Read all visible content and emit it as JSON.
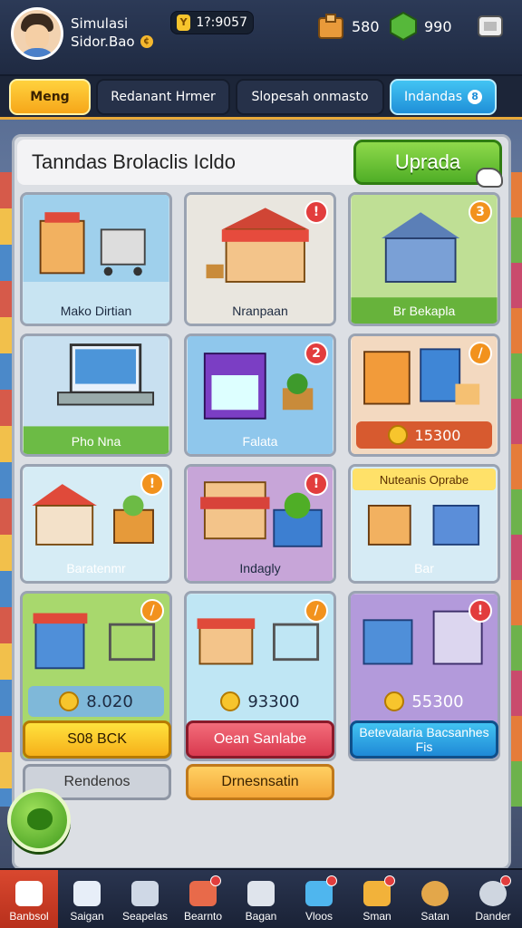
{
  "player": {
    "name": "Simulasi",
    "subtitle": "Sidor.Bao",
    "sub_icon": "coin-mini-icon"
  },
  "currency": {
    "coins": "1?:9057",
    "icon_label": "Y"
  },
  "resources": [
    {
      "value": "580",
      "icon": "box-icon",
      "color": "#e89a3a"
    },
    {
      "value": "990",
      "icon": "cash-icon",
      "color": "#56b83a"
    }
  ],
  "tabs": [
    {
      "label": "Meng"
    },
    {
      "label": "Redanant Hrmer"
    },
    {
      "label": "Slopesah onmasto"
    },
    {
      "label": "Indandas",
      "badge": "8"
    }
  ],
  "panel": {
    "title": "Tanndas Brolaclis Icldo",
    "upgrade_label": "Uprada"
  },
  "cards": [
    {
      "label": "Mako Dirtian",
      "bg": "#9fd0ec"
    },
    {
      "label": "Nranpaan",
      "bg": "#e9e6df",
      "badge": "!"
    },
    {
      "label": "Br Bekapla",
      "bg": "#bfdf95",
      "badge": "3"
    },
    {
      "label": "Pho Nna",
      "bg": "#c8e0f0"
    },
    {
      "label": "Falata",
      "bg": "#8fc7ec",
      "badge": "2"
    },
    {
      "label": "15300",
      "bg": "#f3d9c0",
      "badge": "/"
    },
    {
      "label": "Baratenmr",
      "bg": "#d6ecf5",
      "badge": "!"
    },
    {
      "label": "Indagly",
      "bg": "#c7a5d8",
      "badge": "!"
    },
    {
      "label": "Bar",
      "bg": "#d6ebf5",
      "banner": "Nuteanis Oprabe"
    },
    {
      "label": "8.020",
      "bg": "#a8d86d",
      "badge": "/"
    },
    {
      "label": "93300",
      "bg": "#bfe6f4",
      "badge": "/"
    },
    {
      "label": "55300",
      "bg": "#b39adb",
      "badge": "!"
    }
  ],
  "buttons": {
    "buy_yellow": "S08 BCK",
    "buy_red": "Oean Sanlabe",
    "buy_blue": "Betevalaria Bacsanhes Fis",
    "extra_grey": "Rendenos",
    "extra_orange": "Drnesnsatin"
  },
  "nav": [
    {
      "label": "Banbsol"
    },
    {
      "label": "Saigan"
    },
    {
      "label": "Seapelas"
    },
    {
      "label": "Bearnto"
    },
    {
      "label": "Bagan"
    },
    {
      "label": "Vloos"
    },
    {
      "label": "Sman"
    },
    {
      "label": "Satan"
    },
    {
      "label": "Dander"
    }
  ]
}
